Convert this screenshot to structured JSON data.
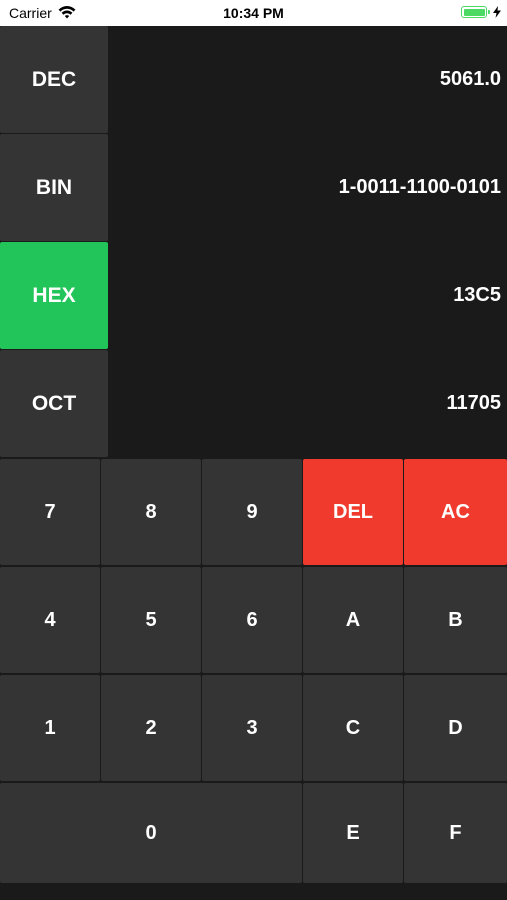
{
  "status_bar": {
    "carrier": "Carrier",
    "time": "10:34 PM"
  },
  "bases": [
    {
      "label": "DEC",
      "value": "5061.0",
      "active": false
    },
    {
      "label": "BIN",
      "value": "1-0011-1100-0101",
      "active": false
    },
    {
      "label": "HEX",
      "value": "13C5",
      "active": true
    },
    {
      "label": "OCT",
      "value": "11705",
      "active": false
    }
  ],
  "keypad": {
    "row1": [
      "7",
      "8",
      "9",
      "DEL",
      "AC"
    ],
    "row2": [
      "4",
      "5",
      "6",
      "A",
      "B"
    ],
    "row3": [
      "1",
      "2",
      "3",
      "C",
      "D"
    ],
    "row4": [
      "0",
      "E",
      "F"
    ]
  },
  "colors": {
    "active_base": "#22c55a",
    "delete_keys": "#ef3a2d",
    "key": "#343434",
    "background": "#1a1a1a"
  },
  "icons": [
    "wifi-icon",
    "battery-icon",
    "charging-bolt-icon"
  ]
}
